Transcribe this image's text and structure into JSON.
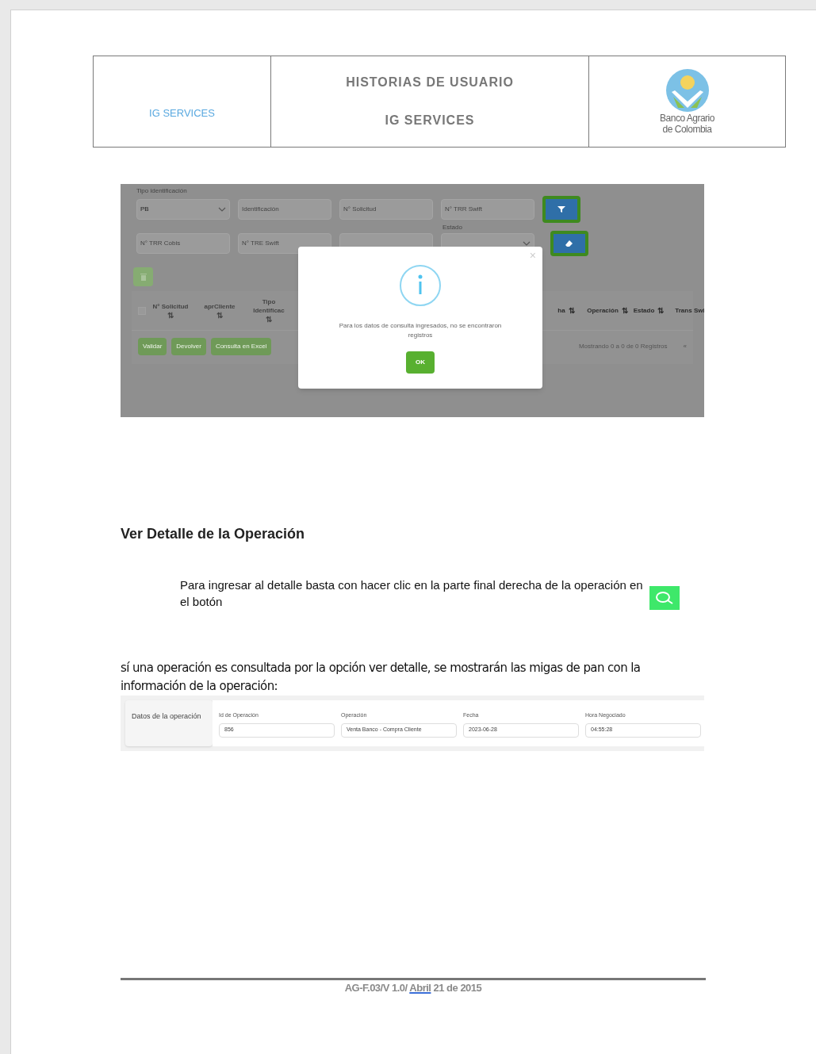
{
  "header": {
    "left_text": "IG SERVICES",
    "title": "HISTORIAS DE USUARIO",
    "subtitle": "IG SERVICES",
    "logo_lines": [
      "Banco Agrario",
      "de Colombia"
    ]
  },
  "search_screenshot": {
    "id_type_label": "Tipo identificación",
    "row_1": [
      {
        "kind": "select",
        "value": "PB"
      },
      {
        "kind": "input",
        "placeholder": "Identificación"
      },
      {
        "kind": "input",
        "placeholder": "N° Solicitud"
      },
      {
        "kind": "input",
        "placeholder": "N° TRR Swift"
      }
    ],
    "status_label": "Estado",
    "row_2": [
      {
        "kind": "input",
        "placeholder": "N° TRR Cobis"
      },
      {
        "kind": "input",
        "placeholder": "N° TRE Swift"
      },
      {
        "kind": "input"
      },
      {
        "kind": "select"
      }
    ],
    "select_all": {
      "checked": false
    },
    "columns_left": [
      {
        "label": "N° Solicitud",
        "sort": "⇅"
      },
      {
        "label": "aprCliente",
        "sort": "⇅"
      },
      {
        "label": "Tipo Identificac",
        "sort": "⇅"
      }
    ],
    "columns_right": [
      {
        "label": "ha",
        "sort": "⇅"
      },
      {
        "label": "Operación",
        "sort": "⇅"
      },
      {
        "label": "Estado",
        "sort": "⇅"
      },
      {
        "label": "Trans Swi"
      }
    ],
    "actions": [
      "Validar",
      "Devolver",
      "Consulta en Excel"
    ],
    "pagination_text": "Mostrando 0 a 0 de 0 Registros",
    "first_page": "«",
    "modal": {
      "close": "×",
      "message": "Para los datos de consulta ingresados, no se encontraron registros",
      "button": "OK"
    }
  },
  "section": {
    "heading": "Ver Detalle de la Operación",
    "instruction": "Para ingresar al detalle basta con hacer clic en la parte final derecha de la operación en el botón",
    "note": "sí una operación es consultada por la opción ver detalle, se mostrarán las migas de pan con la información de la operación:"
  },
  "detail_panel": {
    "title": "Datos de la operación",
    "fields": [
      {
        "label": "Id de Operación",
        "value": "856"
      },
      {
        "label": "Operación",
        "value": "Venta Banco - Compra Cliente"
      },
      {
        "label": "Fecha",
        "value": "2023-06-28"
      },
      {
        "label": "Hora Negociado",
        "value": "04:55:28"
      }
    ]
  },
  "footer": {
    "prefix": "AG-F.03/V 1.0/ ",
    "flagged_word": "Abril",
    "suffix": " 21 de 2015"
  }
}
